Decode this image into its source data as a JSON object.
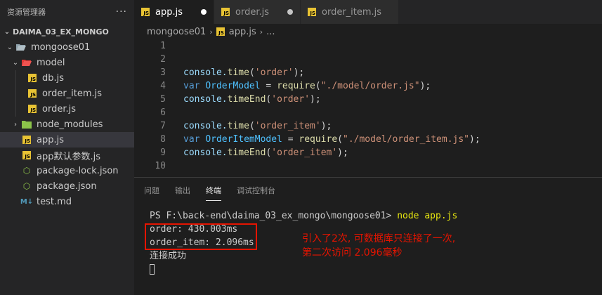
{
  "sidebar": {
    "header": "资源管理器",
    "more": "···",
    "root": "DAIMA_03_EX_MONGO",
    "items": [
      {
        "label": "mongoose01"
      },
      {
        "label": "model"
      },
      {
        "label": "db.js"
      },
      {
        "label": "order_item.js"
      },
      {
        "label": "order.js"
      },
      {
        "label": "node_modules"
      },
      {
        "label": "app.js"
      },
      {
        "label": "app默认参数.js"
      },
      {
        "label": "package-lock.json"
      },
      {
        "label": "package.json"
      },
      {
        "label": "test.md"
      }
    ]
  },
  "tabs": [
    {
      "label": "app.js",
      "active": true,
      "modified": true
    },
    {
      "label": "order.js",
      "active": false,
      "modified": true
    },
    {
      "label": "order_item.js",
      "active": false,
      "modified": false
    }
  ],
  "breadcrumb": {
    "folder": "mongoose01",
    "file": "app.js",
    "tail": "..."
  },
  "code": {
    "line_numbers": [
      "1",
      "2",
      "3",
      "4",
      "5",
      "6",
      "7",
      "8",
      "9",
      "10"
    ],
    "l3": {
      "obj": "console.",
      "fn": "time",
      "open": "(",
      "str": "'order'",
      "close": ");"
    },
    "l4": {
      "kw": "var",
      "var": "OrderModel",
      "eq": " = ",
      "fn": "require",
      "open": "(",
      "str": "\"./model/order.js\"",
      "close": ");"
    },
    "l5": {
      "obj": "console.",
      "fn": "timeEnd",
      "open": "(",
      "str": "'order'",
      "close": ");"
    },
    "l7": {
      "obj": "console.",
      "fn": "time",
      "open": "(",
      "str": "'order_item'",
      "close": ");"
    },
    "l8": {
      "kw": "var",
      "var": "OrderItemModel",
      "eq": " = ",
      "fn": "require",
      "open": "(",
      "str": "\"./model/order_item.js\"",
      "close": ");"
    },
    "l9": {
      "obj": "console.",
      "fn": "timeEnd",
      "open": "(",
      "str": "'order_item'",
      "close": ");"
    }
  },
  "panel": {
    "tabs": [
      "问题",
      "输出",
      "终端",
      "调试控制台"
    ],
    "active_tab": "终端"
  },
  "terminal": {
    "prompt": "PS F:\\back-end\\daima_03_ex_mongo\\mongoose01> ",
    "command": "node app.js",
    "out1": "order: 430.003ms",
    "out2": "order_item: 2.096ms",
    "out3": "连接成功"
  },
  "annotation": {
    "line1": "引入了2次, 可数据库只连接了一次,",
    "line2": "第二次访问 2.096毫秒",
    "color": "#e51400"
  }
}
